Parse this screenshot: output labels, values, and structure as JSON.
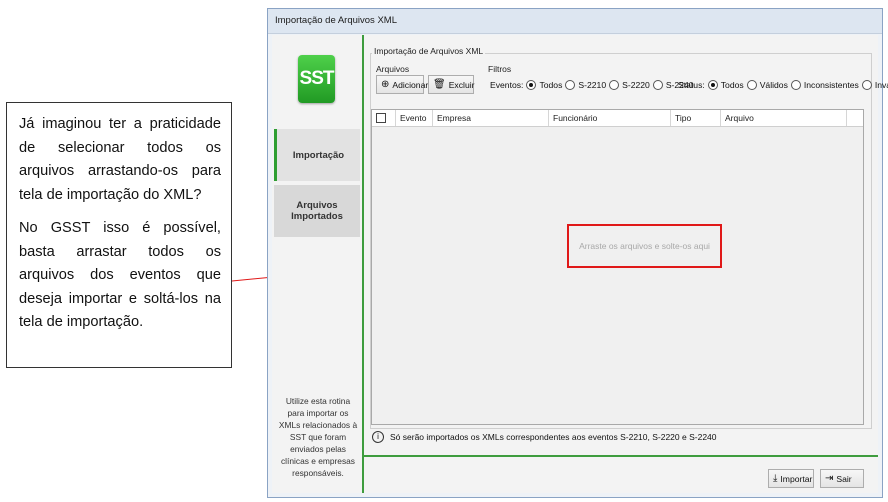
{
  "callout": {
    "paragraph1": "Já imaginou ter a praticidade de selecionar todos os arquivos arrastando-os para tela de importação do XML?",
    "paragraph2": "No GSST isso é possível, basta arrastar todos os arquivos dos eventos que deseja importar e soltá-los na tela de importação."
  },
  "window": {
    "title": "Importação de Arquivos XML"
  },
  "sidebar": {
    "logo_text": "SST",
    "items": [
      {
        "label": "Importação",
        "active": true
      },
      {
        "label": "Arquivos Importados",
        "active": false
      }
    ],
    "note": "Utilize esta rotina para importar os XMLs relacionados à SST que foram enviados pelas clínicas e empresas responsáveis."
  },
  "main": {
    "group_title": "Importação de Arquivos XML",
    "arquivos": {
      "legend": "Arquivos",
      "add_label": "Adicionar",
      "delete_label": "Excluir"
    },
    "filtros": {
      "legend": "Filtros",
      "eventos_label": "Eventos:",
      "eventos_options": [
        "Todos",
        "S-2210",
        "S-2220",
        "S-2240"
      ],
      "eventos_selected": "Todos",
      "status_label": "Status:",
      "status_options": [
        "Todos",
        "Válidos",
        "Inconsistentes",
        "Inválidos"
      ],
      "status_selected": "Todos"
    },
    "table": {
      "columns": [
        "Evento",
        "Empresa",
        "Funcionário",
        "Tipo",
        "Arquivo"
      ]
    },
    "drop_hint": "Arraste os arquivos e solte-os aqui",
    "info_text": "Só serão importados os XMLs correspondentes aos eventos S-2210, S-2220 e S-2240"
  },
  "footer": {
    "import_label": "Importar",
    "exit_label": "Sair"
  },
  "colors": {
    "accent_green": "#3e9c3e",
    "drop_border": "#e01818"
  }
}
